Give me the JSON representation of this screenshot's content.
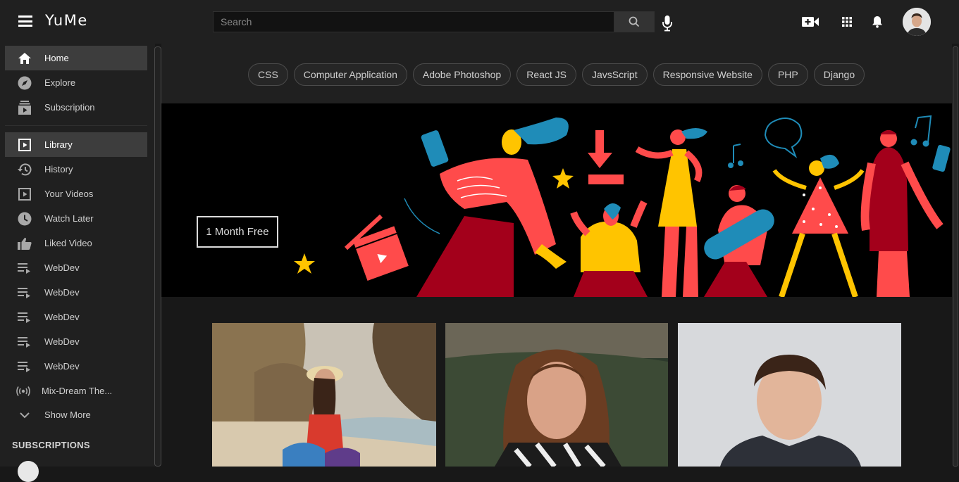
{
  "header": {
    "logo": "YuMe",
    "search_placeholder": "Search"
  },
  "sidebar": {
    "main_items": [
      {
        "label": "Home",
        "icon": "home-icon",
        "active": true
      },
      {
        "label": "Explore",
        "icon": "explore-icon",
        "active": false
      },
      {
        "label": "Subscription",
        "icon": "subscription-icon",
        "active": false
      }
    ],
    "library_items": [
      {
        "label": "Library",
        "icon": "library-icon",
        "active": true
      },
      {
        "label": "History",
        "icon": "history-icon",
        "active": false
      },
      {
        "label": "Your Videos",
        "icon": "your-videos-icon",
        "active": false
      },
      {
        "label": "Watch Later",
        "icon": "clock-icon",
        "active": false
      },
      {
        "label": "Liked Video",
        "icon": "thumb-up-icon",
        "active": false
      },
      {
        "label": "WebDev",
        "icon": "playlist-icon",
        "active": false
      },
      {
        "label": "WebDev",
        "icon": "playlist-icon",
        "active": false
      },
      {
        "label": "WebDev",
        "icon": "playlist-icon",
        "active": false
      },
      {
        "label": "WebDev",
        "icon": "playlist-icon",
        "active": false
      },
      {
        "label": "WebDev",
        "icon": "playlist-icon",
        "active": false
      },
      {
        "label": "Mix-Dream The...",
        "icon": "live-icon",
        "active": false
      },
      {
        "label": "Show More",
        "icon": "chevron-down-icon",
        "active": false
      }
    ],
    "subscriptions_heading": "SUBSCRIPTIONS"
  },
  "chips": [
    "CSS",
    "Computer Application",
    "Adobe Photoshop",
    "React JS",
    "JavsScript",
    "Responsive Website",
    "PHP",
    "Django"
  ],
  "banner": {
    "promo_label": "1 Month Free"
  },
  "colors": {
    "header_bg": "#202020",
    "main_bg": "#181818",
    "accent_red": "#ff4b4b",
    "accent_yellow": "#ffc400",
    "accent_blue": "#1f8cb8",
    "accent_dark_red": "#a3001b"
  }
}
